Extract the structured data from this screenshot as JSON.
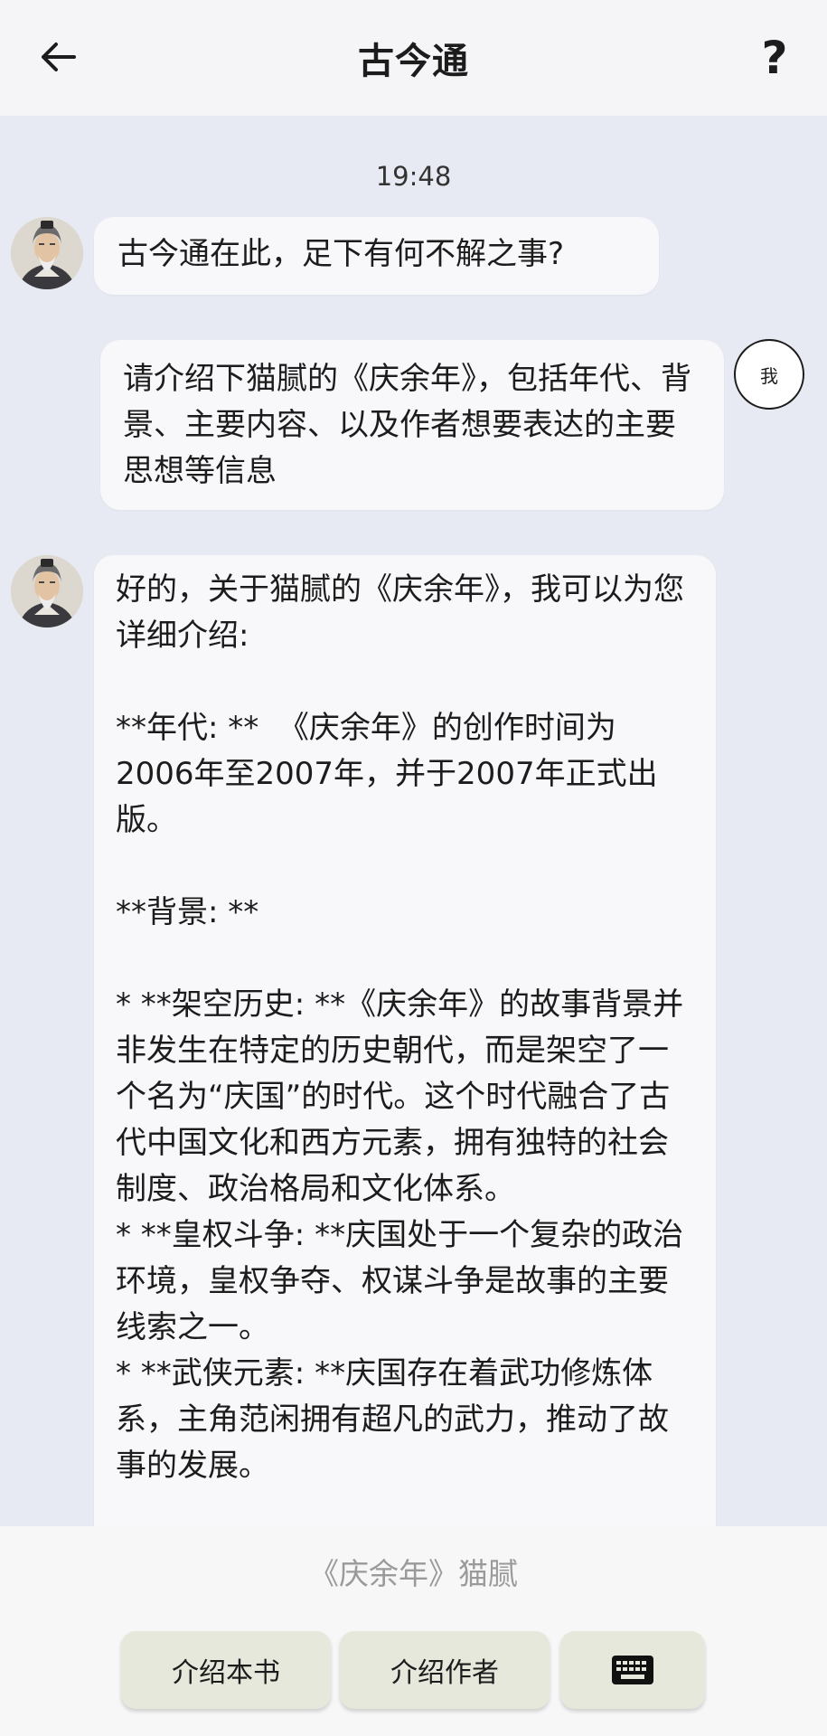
{
  "header": {
    "title": "古今通",
    "back_icon": "arrow-left-icon",
    "help_label": "?"
  },
  "chat": {
    "timestamp": "19:48",
    "messages": [
      {
        "role": "assistant",
        "text": "古今通在此，足下有何不解之事?"
      },
      {
        "role": "user",
        "avatar_label": "我",
        "text": "请介绍下猫腻的《庆余年》，包括年代、背景、主要内容、以及作者想要表达的主要思想等信息"
      },
      {
        "role": "assistant",
        "text": "好的，关于猫腻的《庆余年》，我可以为您详细介绍:\n\n**年代: **  《庆余年》的创作时间为2006年至2007年，并于2007年正式出版。\n\n**背景: **\n\n* **架空历史: **《庆余年》的故事背景并非发生在特定的历史朝代，而是架空了一个名为“庆国”的时代。这个时代融合了古代中国文化和西方元素，拥有独特的社会制度、政治格局和文化体系。\n* **皇权斗争: **庆国处于一个复杂的政治环境，皇权争夺、权谋斗争是故事的主要线索之一。\n* **武侠元素: **庆国存在着武功修炼体系，主角范闲拥有超凡的武力，推动了故事的发展。"
      }
    ]
  },
  "bottom": {
    "book_hint": "《庆余年》猫腻",
    "buttons": {
      "intro_book": "介绍本书",
      "intro_author": "介绍作者",
      "keyboard_icon": "keyboard-icon"
    }
  },
  "colors": {
    "header_bg": "#f5f5f7",
    "chat_bg": "#e7eaf2",
    "bubble_bg": "#f8f8fa",
    "button_bg": "#e6e8dc",
    "hint_text": "#9a9a9a"
  }
}
